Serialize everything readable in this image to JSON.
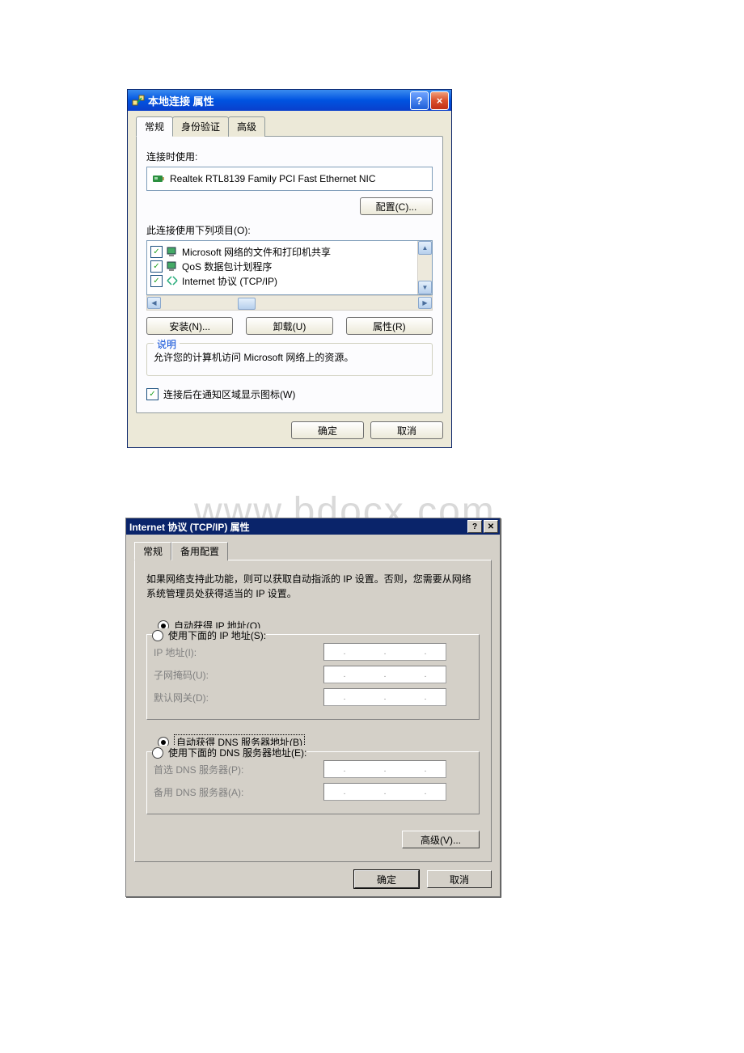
{
  "watermark": "www.bdocx.com",
  "dlg1": {
    "title": "本地连接 属性",
    "tabs": [
      "常规",
      "身份验证",
      "高级"
    ],
    "connect_using_label": "连接时使用:",
    "adapter": "Realtek RTL8139 Family PCI Fast Ethernet NIC",
    "configure_btn": "配置(C)...",
    "items_used_label": "此连接使用下列项目(O):",
    "items": [
      {
        "checked": true,
        "label": "Microsoft 网络的文件和打印机共享"
      },
      {
        "checked": true,
        "label": "QoS 数据包计划程序"
      },
      {
        "checked": true,
        "label": "Internet 协议 (TCP/IP)"
      }
    ],
    "install_btn": "安装(N)...",
    "uninstall_btn": "卸载(U)",
    "properties_btn": "属性(R)",
    "desc_group_title": "说明",
    "desc_text": "允许您的计算机访问 Microsoft 网络上的资源。",
    "show_icon_label": "连接后在通知区域显示图标(W)",
    "ok_btn": "确定",
    "cancel_btn": "取消"
  },
  "dlg2": {
    "title": "Internet 协议 (TCP/IP) 属性",
    "tabs": [
      "常规",
      "备用配置"
    ],
    "desc": "如果网络支持此功能，则可以获取自动指派的 IP 设置。否则，您需要从网络系统管理员处获得适当的 IP 设置。",
    "radio_auto_ip": "自动获得 IP 地址(O)",
    "radio_manual_ip": "使用下面的 IP 地址(S):",
    "ip_label": "IP 地址(I):",
    "subnet_label": "子网掩码(U):",
    "gateway_label": "默认网关(D):",
    "radio_auto_dns": "自动获得 DNS 服务器地址(B)",
    "radio_manual_dns": "使用下面的 DNS 服务器地址(E):",
    "dns_pref_label": "首选 DNS 服务器(P):",
    "dns_alt_label": "备用 DNS 服务器(A):",
    "advanced_btn": "高级(V)...",
    "ok_btn": "确定",
    "cancel_btn": "取消"
  }
}
